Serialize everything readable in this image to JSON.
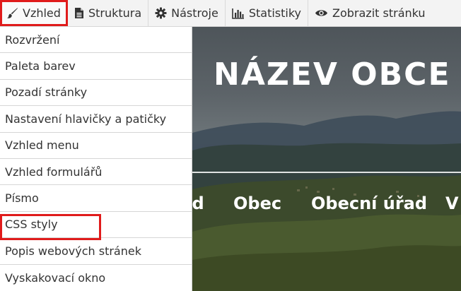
{
  "toolbar": {
    "items": [
      {
        "label": "Vzhled",
        "icon": "brush-icon"
      },
      {
        "label": "Struktura",
        "icon": "file-icon"
      },
      {
        "label": "Nástroje",
        "icon": "gear-icon"
      },
      {
        "label": "Statistiky",
        "icon": "bar-chart-icon"
      },
      {
        "label": "Zobrazit stránku",
        "icon": "eye-icon"
      }
    ]
  },
  "hero": {
    "title": "NÁZEV OBCE",
    "nav": [
      "od",
      "Obec",
      "Obecní úřad",
      "V"
    ]
  },
  "dropdown": {
    "items": [
      "Rozvržení",
      "Paleta barev",
      "Pozadí stránky",
      "Nastavení hlavičky a patičky",
      "Vzhled menu",
      "Vzhled formulářů",
      "Písmo",
      "CSS styly",
      "Popis webových stránek",
      "Vyskakovací okno"
    ]
  },
  "colors": {
    "highlight": "#e01b1b",
    "toolbar_bg": "#f3f3f3",
    "text": "#333333"
  }
}
